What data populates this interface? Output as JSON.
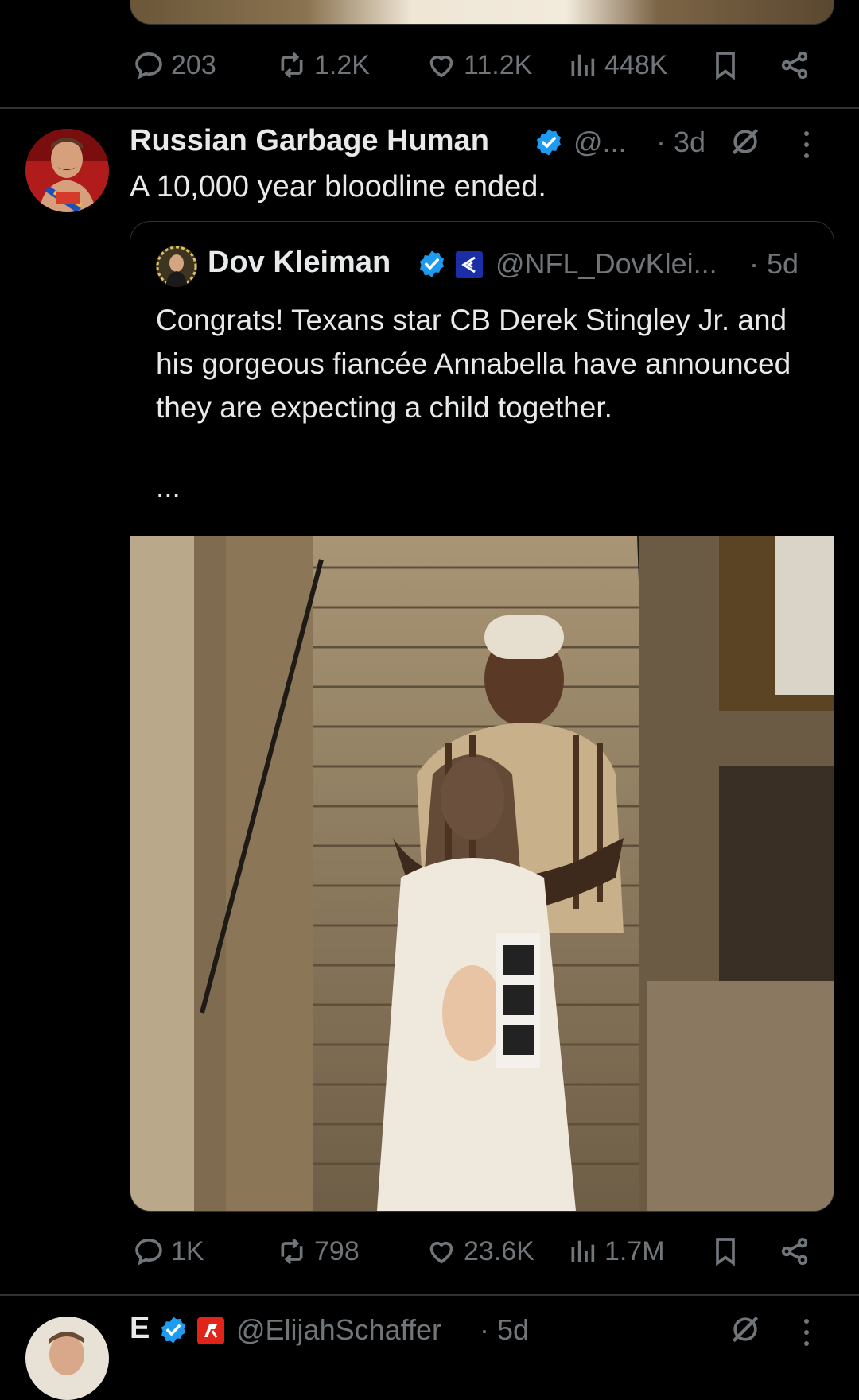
{
  "prev_tweet": {
    "replies": "203",
    "reposts": "1.2K",
    "likes": "11.2K",
    "views": "448K"
  },
  "tweet": {
    "author_name": "Russian Garbage Human",
    "handle": "@...",
    "time": "· 3d",
    "text": "A 10,000 year bloodline ended.",
    "quote": {
      "author_name": "Dov Kleiman",
      "handle": "@NFL_DovKlei...",
      "time": "· 5d",
      "text": "Congrats! Texans star CB Derek Stingley Jr. and his gorgeous fiancée Annabella have announced they are expecting a child together.",
      "more": "..."
    },
    "replies": "1K",
    "reposts": "798",
    "likes": "23.6K",
    "views": "1.7M"
  },
  "next_tweet": {
    "author_name": "E",
    "handle": "@ElijahSchaffer",
    "time": "· 5d"
  },
  "colors": {
    "background": "#000000",
    "text": "#e7e9ea",
    "muted": "#71767b",
    "verified": "#1d9bf0",
    "border": "#2f3336"
  },
  "icons": [
    "reply-icon",
    "repost-icon",
    "like-icon",
    "views-icon",
    "bookmark-icon",
    "share-icon",
    "verified-icon",
    "grok-icon",
    "more-icon"
  ]
}
